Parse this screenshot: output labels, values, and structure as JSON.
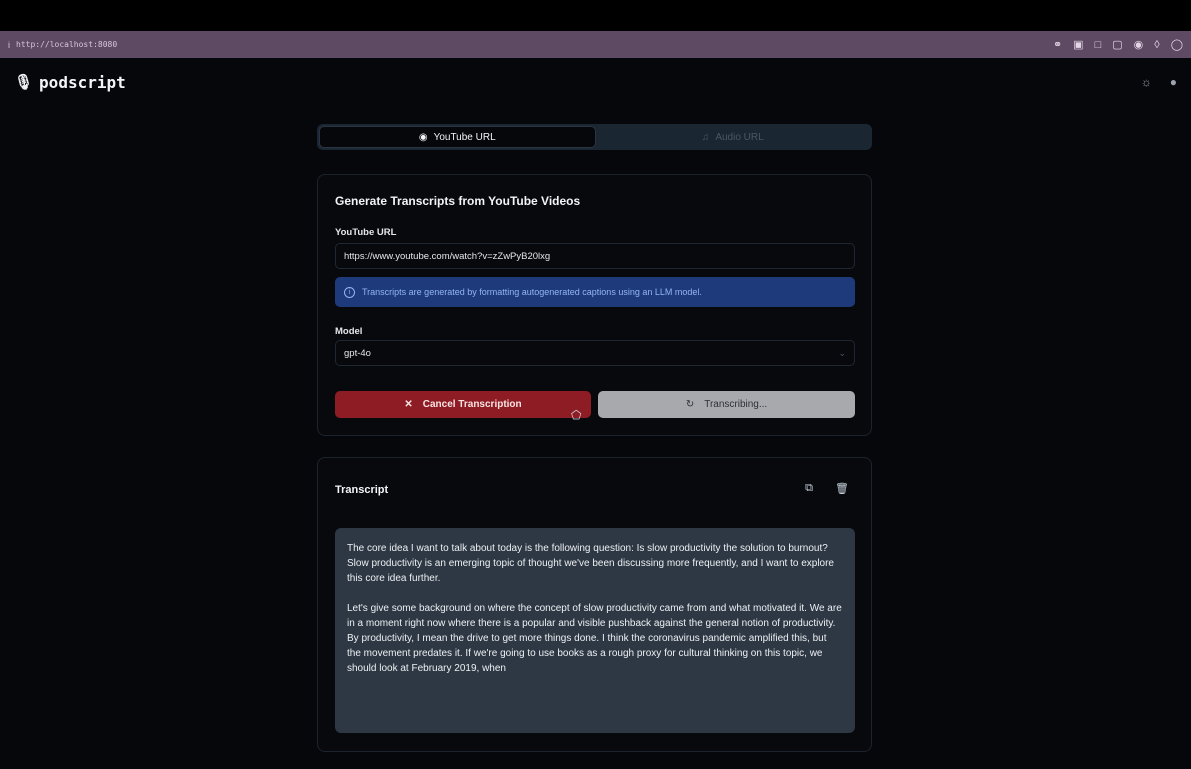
{
  "browser": {
    "info_icon": "i",
    "url": "http://localhost:8080"
  },
  "app": {
    "name": "podscript"
  },
  "tabs": [
    {
      "label": "YouTube URL",
      "icon": "video-icon",
      "active": true
    },
    {
      "label": "Audio URL",
      "icon": "audio-icon",
      "active": false
    }
  ],
  "generator": {
    "title": "Generate Transcripts from YouTube Videos",
    "url_label": "YouTube URL",
    "url_value": "https://www.youtube.com/watch?v=zZwPyB20lxg",
    "info_text": "Transcripts are generated by formatting autogenerated captions using an LLM model.",
    "model_label": "Model",
    "model_value": "gpt-4o",
    "cancel_label": "Cancel Transcription",
    "transcribing_label": "Transcribing..."
  },
  "transcript": {
    "title": "Transcript",
    "paragraphs": [
      "The core idea I want to talk about today is the following question: Is slow productivity the solution to burnout? Slow productivity is an emerging topic of thought we've been discussing more frequently, and I want to explore this core idea further.",
      "Let's give some background on where the concept of slow productivity came from and what motivated it. We are in a moment right now where there is a popular and visible pushback against the general notion of productivity. By productivity, I mean the drive to get more things done. I think the coronavirus pandemic amplified this, but the movement predates it. If we're going to use books as a rough proxy for cultural thinking on this topic, we should look at February 2019, when"
    ]
  },
  "colors": {
    "background": "#06070b",
    "browser_bar": "#5e4a62",
    "cancel_button": "#8e1c24",
    "info_banner": "#1e3a7a",
    "transcript_box": "#2d3844"
  }
}
